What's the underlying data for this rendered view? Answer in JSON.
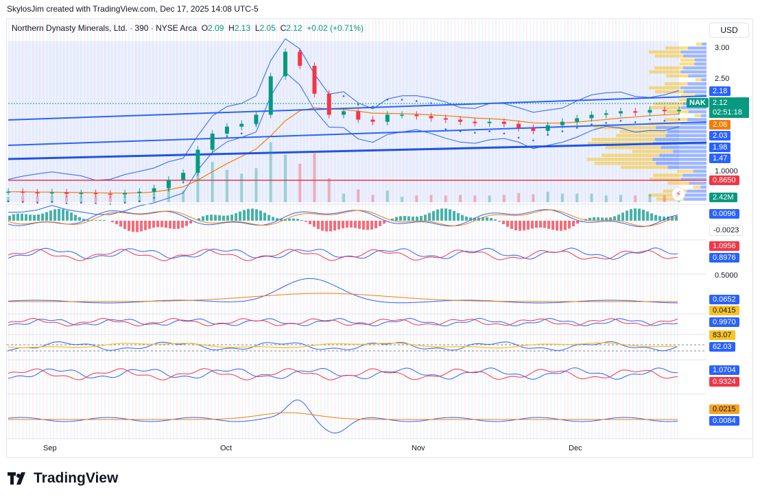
{
  "credit": "SkylosJim created with TradingView.com, Dec 17, 2025 14:08 UTC-5",
  "legend": {
    "name": "Northern Dynasty Minerals, Ltd. · 390 · NYSE Arca",
    "o_label": "O",
    "o": "2.09",
    "h_label": "H",
    "h": "2.13",
    "l_label": "L",
    "l": "2.05",
    "c_label": "C",
    "c": "2.12",
    "change": "+0.02 (+0.71%)"
  },
  "currency": "USD",
  "symbol": "NAK",
  "last_price": "2.12",
  "countdown": "02:51:18",
  "price_axis_ticks": [
    "3.00",
    "2.50",
    "1.0000"
  ],
  "price_badges": [
    {
      "text": "2.18",
      "color": "#2962ff"
    },
    {
      "text": "2.08",
      "color": "#f57c00"
    },
    {
      "text": "2.03",
      "color": "#2962ff"
    },
    {
      "text": "1.98",
      "color": "#2962ff"
    },
    {
      "text": "1.47",
      "color": "#2962ff"
    },
    {
      "text": "0.8650",
      "color": "#f23645"
    },
    {
      "text": "2.42M",
      "color": "#089981"
    }
  ],
  "indicator_badges": [
    {
      "text": "0.0096",
      "color": "#2962ff"
    },
    {
      "text": "-0.0023",
      "color": "#ffffff"
    },
    {
      "text": "1.0956",
      "color": "#f23645"
    },
    {
      "text": "0.8976",
      "color": "#2962ff"
    },
    {
      "text": "0.0652",
      "color": "#2962ff"
    },
    {
      "text": "0.0415",
      "color": "#f7c325"
    },
    {
      "text": "0.9970",
      "color": "#2962ff"
    },
    {
      "text": "83.07",
      "color": "#f7c325"
    },
    {
      "text": "62.03",
      "color": "#2962ff"
    },
    {
      "text": "1.0704",
      "color": "#2962ff"
    },
    {
      "text": "0.9324",
      "color": "#f23645"
    },
    {
      "text": "0.0215",
      "color": "#f7a325"
    },
    {
      "text": "0.0084",
      "color": "#2962ff"
    }
  ],
  "indicator_axis_ticks": [
    "0.5000"
  ],
  "x_axis": [
    "Sep",
    "Oct",
    "Nov",
    "Dec"
  ],
  "brand": "TradingView",
  "colors": {
    "up": "#089981",
    "down": "#f23645",
    "accent": "#2962ff",
    "ema": "#f57c00"
  },
  "chart_data": {
    "type": "candlestick",
    "symbol": "NAK",
    "interval": "390",
    "ylim": [
      0.8,
      3.2
    ],
    "x": [
      "Aug 26",
      "Aug 28",
      "Sep 2",
      "Sep 4",
      "Sep 8",
      "Sep 10",
      "Sep 12",
      "Sep 16",
      "Sep 18",
      "Sep 22",
      "Sep 24",
      "Sep 26",
      "Sep 30",
      "Oct 2",
      "Oct 3",
      "Oct 6",
      "Oct 7",
      "Oct 8",
      "Oct 9",
      "Oct 10",
      "Oct 13",
      "Oct 14",
      "Oct 15",
      "Oct 16",
      "Oct 17",
      "Oct 20",
      "Oct 22",
      "Oct 24",
      "Oct 28",
      "Oct 30",
      "Nov 3",
      "Nov 5",
      "Nov 7",
      "Nov 11",
      "Nov 13",
      "Nov 17",
      "Nov 19",
      "Nov 21",
      "Nov 25",
      "Nov 28",
      "Dec 2",
      "Dec 4",
      "Dec 8",
      "Dec 10",
      "Dec 12",
      "Dec 16",
      "Dec 17"
    ],
    "close": [
      0.95,
      0.94,
      0.93,
      0.94,
      0.92,
      0.93,
      0.92,
      0.91,
      0.93,
      0.95,
      1.0,
      1.12,
      1.22,
      1.55,
      1.78,
      1.88,
      1.92,
      2.05,
      2.6,
      2.95,
      2.75,
      2.35,
      2.05,
      2.1,
      1.98,
      1.95,
      2.05,
      2.05,
      2.03,
      2.0,
      1.98,
      1.95,
      1.93,
      1.95,
      1.92,
      1.86,
      1.82,
      1.9,
      1.95,
      2.0,
      2.05,
      2.07,
      2.1,
      2.08,
      2.12,
      2.1,
      2.12
    ],
    "overlays": [
      "Bollinger Bands",
      "EMA",
      "Parabolic SAR",
      "Trend channel",
      "Volume profile"
    ],
    "volume_last": "2.42M"
  }
}
